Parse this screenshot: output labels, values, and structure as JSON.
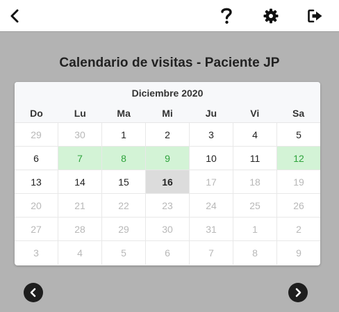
{
  "topbar": {
    "back_icon": "chevron-left-icon",
    "help_icon": "question-icon",
    "settings_icon": "gear-icon",
    "logout_icon": "logout-icon"
  },
  "page_title": "Calendario de visitas - Paciente JP",
  "calendar": {
    "month_label": "Diciembre 2020",
    "weekdays": [
      "Do",
      "Lu",
      "Ma",
      "Mi",
      "Ju",
      "Vi",
      "Sa"
    ],
    "weeks": [
      [
        {
          "d": "29",
          "s": "other"
        },
        {
          "d": "30",
          "s": "other"
        },
        {
          "d": "1",
          "s": ""
        },
        {
          "d": "2",
          "s": ""
        },
        {
          "d": "3",
          "s": ""
        },
        {
          "d": "4",
          "s": ""
        },
        {
          "d": "5",
          "s": ""
        }
      ],
      [
        {
          "d": "6",
          "s": ""
        },
        {
          "d": "7",
          "s": "visit"
        },
        {
          "d": "8",
          "s": "visit"
        },
        {
          "d": "9",
          "s": "visit"
        },
        {
          "d": "10",
          "s": ""
        },
        {
          "d": "11",
          "s": ""
        },
        {
          "d": "12",
          "s": "visit"
        }
      ],
      [
        {
          "d": "13",
          "s": ""
        },
        {
          "d": "14",
          "s": ""
        },
        {
          "d": "15",
          "s": ""
        },
        {
          "d": "16",
          "s": "today"
        },
        {
          "d": "17",
          "s": "other"
        },
        {
          "d": "18",
          "s": "other"
        },
        {
          "d": "19",
          "s": "other"
        }
      ],
      [
        {
          "d": "20",
          "s": "other"
        },
        {
          "d": "21",
          "s": "other"
        },
        {
          "d": "22",
          "s": "other"
        },
        {
          "d": "23",
          "s": "other"
        },
        {
          "d": "24",
          "s": "other"
        },
        {
          "d": "25",
          "s": "other"
        },
        {
          "d": "26",
          "s": "other"
        }
      ],
      [
        {
          "d": "27",
          "s": "other"
        },
        {
          "d": "28",
          "s": "other"
        },
        {
          "d": "29",
          "s": "other"
        },
        {
          "d": "30",
          "s": "other"
        },
        {
          "d": "31",
          "s": "other"
        },
        {
          "d": "1",
          "s": "other"
        },
        {
          "d": "2",
          "s": "other"
        }
      ],
      [
        {
          "d": "3",
          "s": "other"
        },
        {
          "d": "4",
          "s": "other"
        },
        {
          "d": "5",
          "s": "other"
        },
        {
          "d": "6",
          "s": "other"
        },
        {
          "d": "7",
          "s": "other"
        },
        {
          "d": "8",
          "s": "other"
        },
        {
          "d": "9",
          "s": "other"
        }
      ]
    ],
    "colors": {
      "visit_bg": "#d3f3d6",
      "visit_text": "#2ea33c",
      "today_bg": "#dcdcdc",
      "other_month_text": "#b8b8b8"
    }
  },
  "nav": {
    "prev_icon": "circle-chevron-left-icon",
    "next_icon": "circle-chevron-right-icon"
  }
}
